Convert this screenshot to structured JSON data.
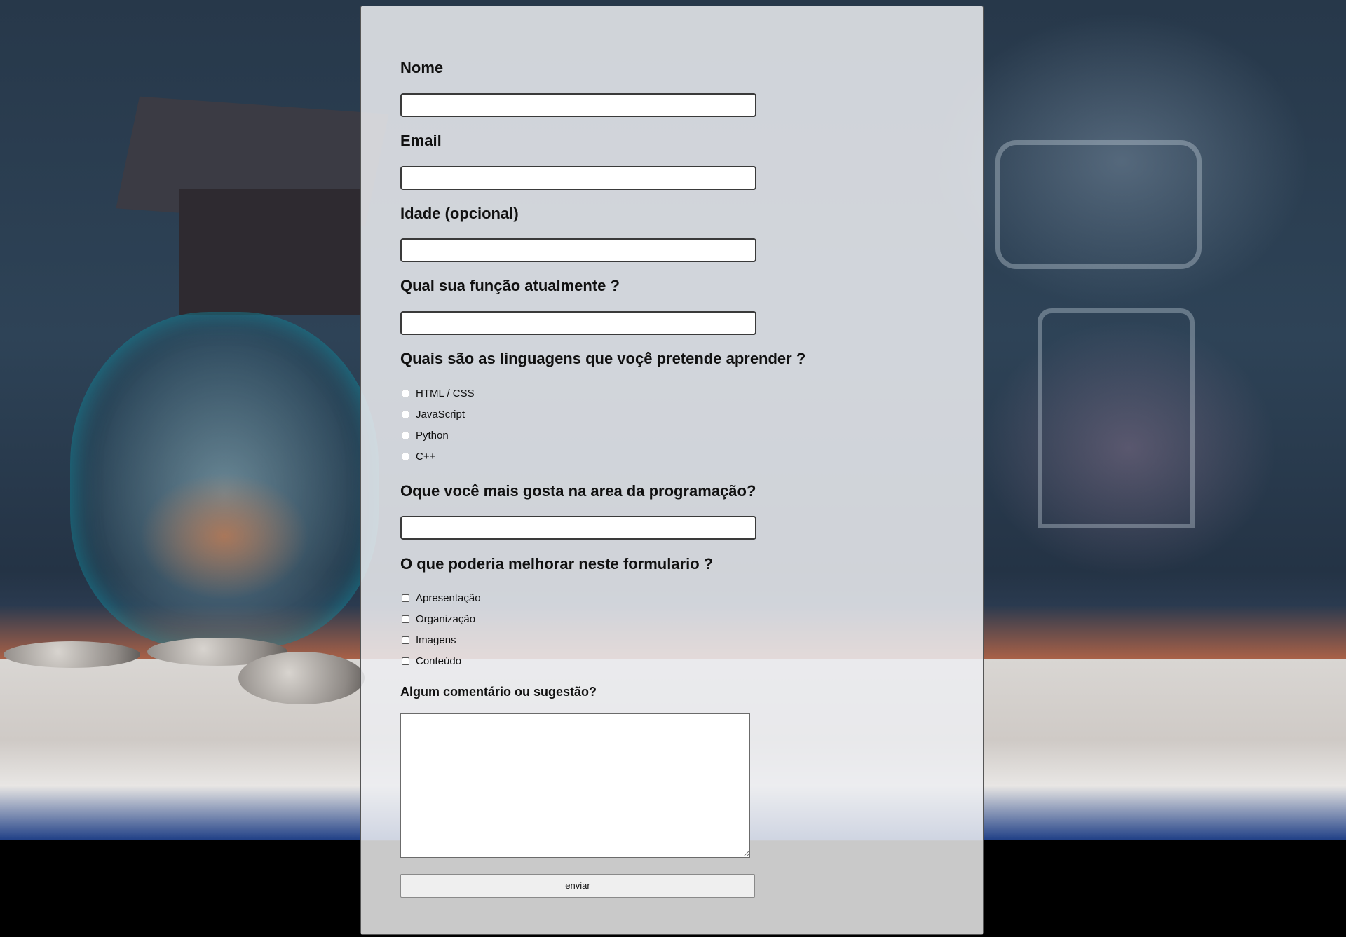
{
  "form": {
    "nome_label": "Nome",
    "email_label": "Email",
    "idade_label": "Idade (opcional)",
    "funcao_label": "Qual sua função atualmente ?",
    "linguagens_label": "Quais são as linguagens que voçê pretende aprender ?",
    "linguagens_options": [
      "HTML / CSS",
      "JavaScript",
      "Python",
      "C++"
    ],
    "gosta_label": "Oque você mais gosta na area da programação?",
    "melhorar_label": "O que poderia melhorar neste formulario ?",
    "melhorar_options": [
      "Apresentação",
      "Organização",
      "Imagens",
      "Conteúdo"
    ],
    "comentario_label": "Algum comentário ou sugestão?",
    "submit_label": "enviar"
  }
}
